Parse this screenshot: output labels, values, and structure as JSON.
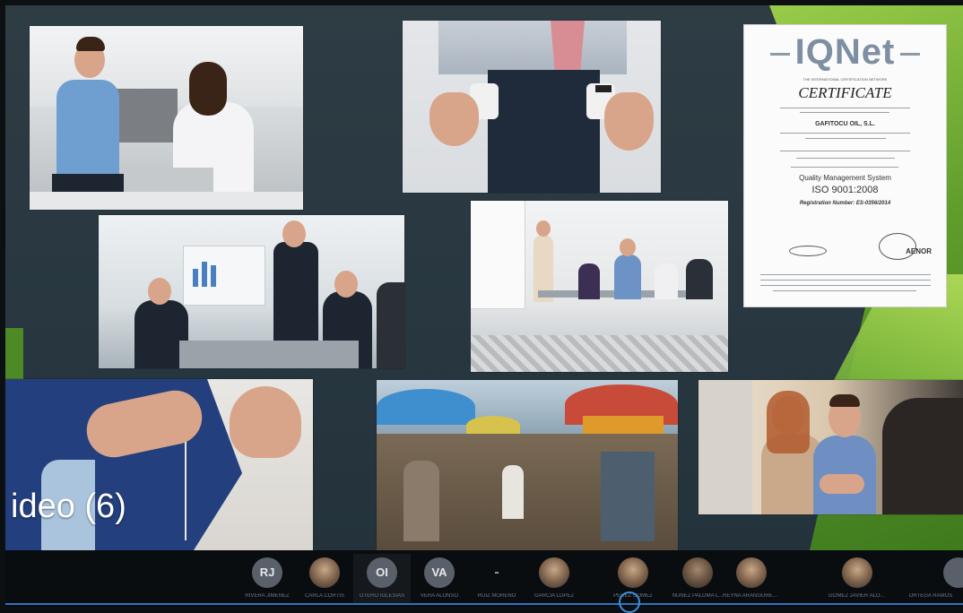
{
  "slide": {
    "label": "ideo (6)",
    "certificate": {
      "logo": "IQNet",
      "network": "THE INTERNATIONAL CERTIFICATION NETWORK",
      "title": "CERTIFICATE",
      "company": "GAFITOCU OIL, S.L.",
      "system": "Quality Management System",
      "standard": "ISO 9001:2008",
      "registration": "Registration Number: ES-0356/2014",
      "issuer": "AENOR"
    },
    "photos": [
      "office-kitchen-chat",
      "empty-pockets",
      "office-presentation",
      "conference-presentation",
      "sewing-fabric",
      "street-market",
      "handshake-agreement"
    ]
  },
  "participants": [
    {
      "initials": "RJ",
      "name": "RIVERA JIMENEZ",
      "type": "initials"
    },
    {
      "initials": "",
      "name": "CARLA CORTIS",
      "type": "photo"
    },
    {
      "initials": "OI",
      "name": "OTERO IGLESIAS",
      "type": "initials"
    },
    {
      "initials": "VA",
      "name": "VERA ALONSO",
      "type": "initials"
    },
    {
      "initials": "-",
      "name": "RUIZ MORENO",
      "type": "dash"
    },
    {
      "initials": "",
      "name": "GARCIA LOPEZ",
      "type": "photo"
    },
    {
      "initials": "",
      "name": "PEREZ GOMEZ",
      "type": "photo"
    },
    {
      "initials": "",
      "name": "NUÑEZ PALOMA L...",
      "type": "photo"
    },
    {
      "initials": "",
      "name": "REYNA ARANGUREN GUTIERREZ",
      "type": "photo"
    },
    {
      "initials": "",
      "name": "GOMEZ JAVIER ALONSO CERVERA",
      "type": "photo"
    },
    {
      "initials": "",
      "name": "ORTEGA RAMOS",
      "type": "photo"
    }
  ],
  "colors": {
    "slide_bg": "#2b3a42",
    "accent_green": "#6faf36",
    "taskbar_bg": "#0a0d10",
    "progress": "#2f72c0"
  }
}
